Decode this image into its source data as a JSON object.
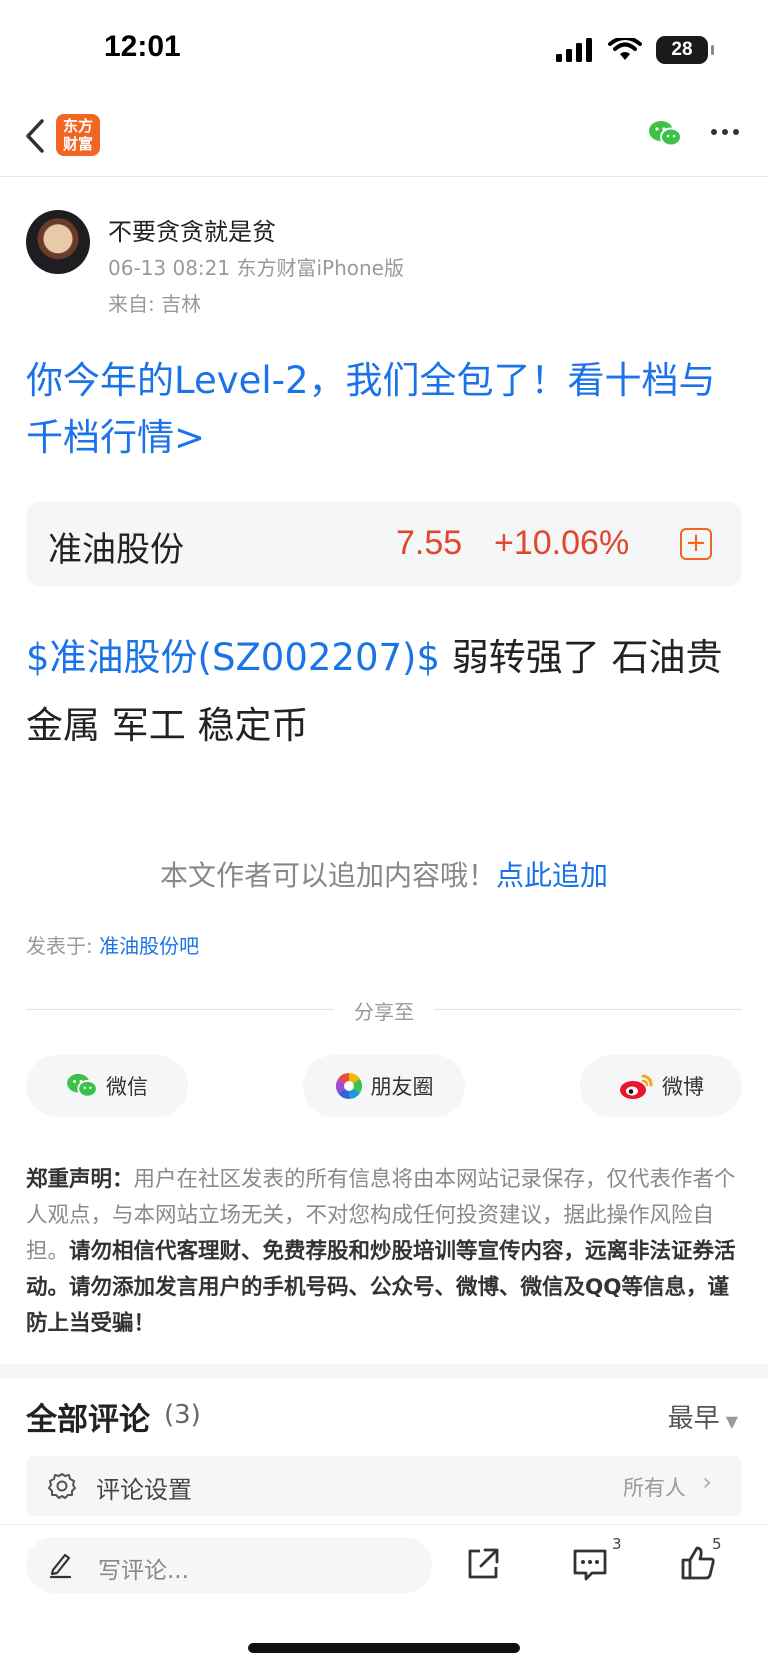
{
  "status_bar": {
    "time": "12:01",
    "battery": "28"
  },
  "nav": {
    "logo_line1": "东方",
    "logo_line2": "财富"
  },
  "author": {
    "name": "不要贪贪就是贫",
    "meta": "06-13 08:21 东方财富iPhone版",
    "location": "来自: 吉林"
  },
  "headline": "你今年的Level-2，我们全包了！看十档与千档行情>",
  "stock": {
    "name": "准油股份",
    "price": "7.55",
    "change": "+10.06%"
  },
  "post": {
    "link": "$准油股份(SZ002207)$",
    "text": " 弱转强了 石油贵金属 军工 稳定币"
  },
  "append": {
    "text": "本文作者可以追加内容哦！",
    "link": "点此追加"
  },
  "published": {
    "label": "发表于: ",
    "link": "准油股份吧"
  },
  "share": {
    "label": "分享至",
    "wechat": "微信",
    "moments": "朋友圈",
    "weibo": "微博"
  },
  "disclaimer": {
    "title": "郑重声明：",
    "normal": "用户在社区发表的所有信息将由本网站记录保存，仅代表作者个人观点，与本网站立场无关，不对您构成任何投资建议，据此操作风险自担。",
    "bold": "请勿相信代客理财、免费荐股和炒股培训等宣传内容，远离非法证券活动。请勿添加发言用户的手机号码、公众号、微博、微信及QQ等信息，谨防上当受骗！"
  },
  "comments": {
    "title": "全部评论",
    "count": "(3)",
    "sort": "最早",
    "setting_label": "评论设置",
    "setting_value": "所有人"
  },
  "bottom_bar": {
    "write_placeholder": "写评论...",
    "comment_badge": "3",
    "like_badge": "5"
  },
  "colors": {
    "accent_blue": "#1a73e8",
    "rise_red": "#e0482b",
    "brand_orange": "#f26522"
  }
}
